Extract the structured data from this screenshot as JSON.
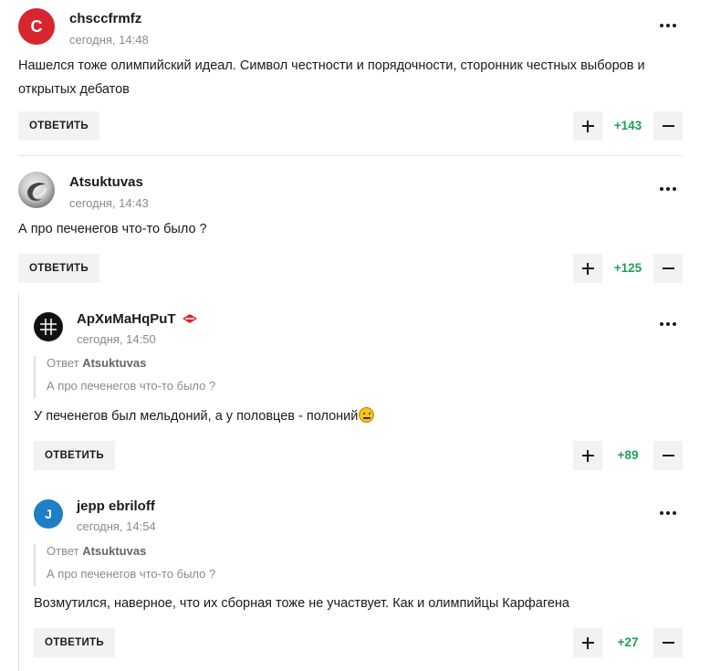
{
  "reply_label": "ОТВЕТИТЬ",
  "comments": [
    {
      "avatar_letter": "C",
      "avatar_color": "#d7262f",
      "user": "chsccfrmfz",
      "time": "сегодня, 14:48",
      "text": "Нашелся тоже олимпийский идеал. Символ честности и порядочности, сторонник честных выборов и открытых дебатов",
      "score": "+143"
    },
    {
      "avatar_icon": "chrome-logo-icon",
      "user": "Atsuktuvas",
      "time": "сегодня, 14:43",
      "text": "А про печенегов что-то было ?",
      "score": "+125"
    },
    {
      "avatar_icon": "hash-logo-icon",
      "user": "АрХиМаНqРuТ",
      "team_badge": "spartak-badge-icon",
      "time": "сегодня, 14:50",
      "quote_prefix": "Ответ",
      "quote_author": "Atsuktuvas",
      "quote_text": "А про печенегов что-то было ?",
      "text": "У печенегов был мельдоний, а у половцев - полоний",
      "emoji": "neutral-face-emoji",
      "score": "+89"
    },
    {
      "avatar_letter": "J",
      "avatar_color": "#1e7fc6",
      "user": "jepp ebriloff",
      "time": "сегодня, 14:54",
      "quote_prefix": "Ответ",
      "quote_author": "Atsuktuvas",
      "quote_text": "А про печенегов что-то было ?",
      "text": "Возмутился, наверное, что их сборная тоже не участвует. Как и олимпийцы Карфагена",
      "score": "+27"
    }
  ],
  "colors": {
    "score_positive": "#1e9e5c",
    "button_bg": "#f2f2f2",
    "muted_text": "#8a8a8a"
  }
}
